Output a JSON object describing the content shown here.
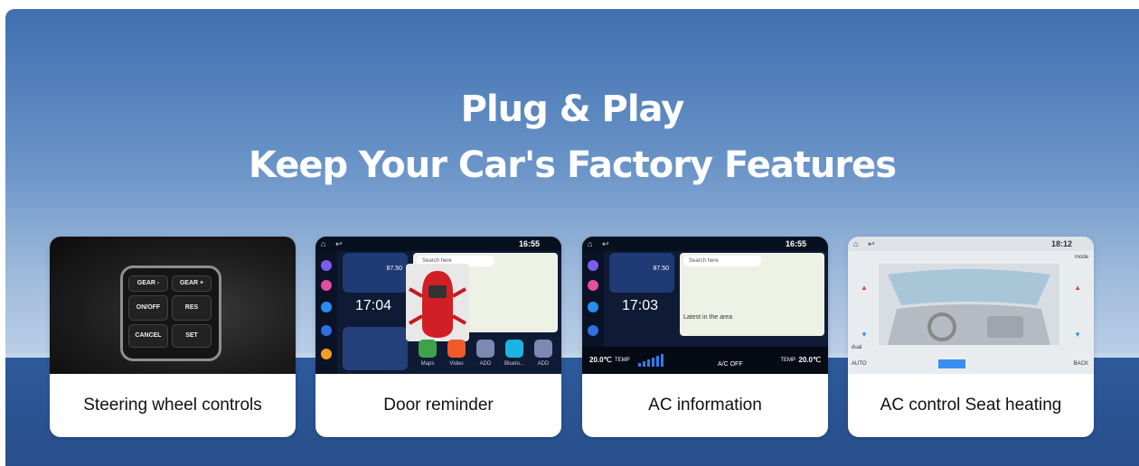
{
  "headline": {
    "line1": "Plug & Play",
    "line2": "Keep Your Car's Factory Features"
  },
  "cards": [
    {
      "caption": "Steering wheel controls",
      "buttons": [
        "GEAR -",
        "GEAR +",
        "ON/OFF",
        "RES",
        "CANCEL",
        "SET"
      ]
    },
    {
      "caption": "Door reminder",
      "time_bar": "16:55",
      "clock": "17:04",
      "radio": "87.50",
      "search_placeholder": "Search here",
      "apps": [
        "Maps",
        "Video",
        "ADD",
        "Blueto...",
        "ADD"
      ]
    },
    {
      "caption": "AC information",
      "time_bar": "16:55",
      "clock": "17:03",
      "radio": "87.50",
      "search_placeholder": "Search here",
      "map_label": "Latest in the area",
      "ac_left": "20.0℃",
      "ac_right": "20.0℃",
      "temp_label": "TEMP",
      "ac_status": "A/C OFF"
    },
    {
      "caption": "AC control Seat heating",
      "time_bar": "18:12",
      "buttons": [
        "dual",
        "AUTO",
        "BACK",
        "mode"
      ]
    }
  ],
  "colors": {
    "sky_top": "#3f6fb0",
    "sky_bottom": "#c7d7ea",
    "floor": "#2d5a9a",
    "card_bg": "#ffffff"
  }
}
